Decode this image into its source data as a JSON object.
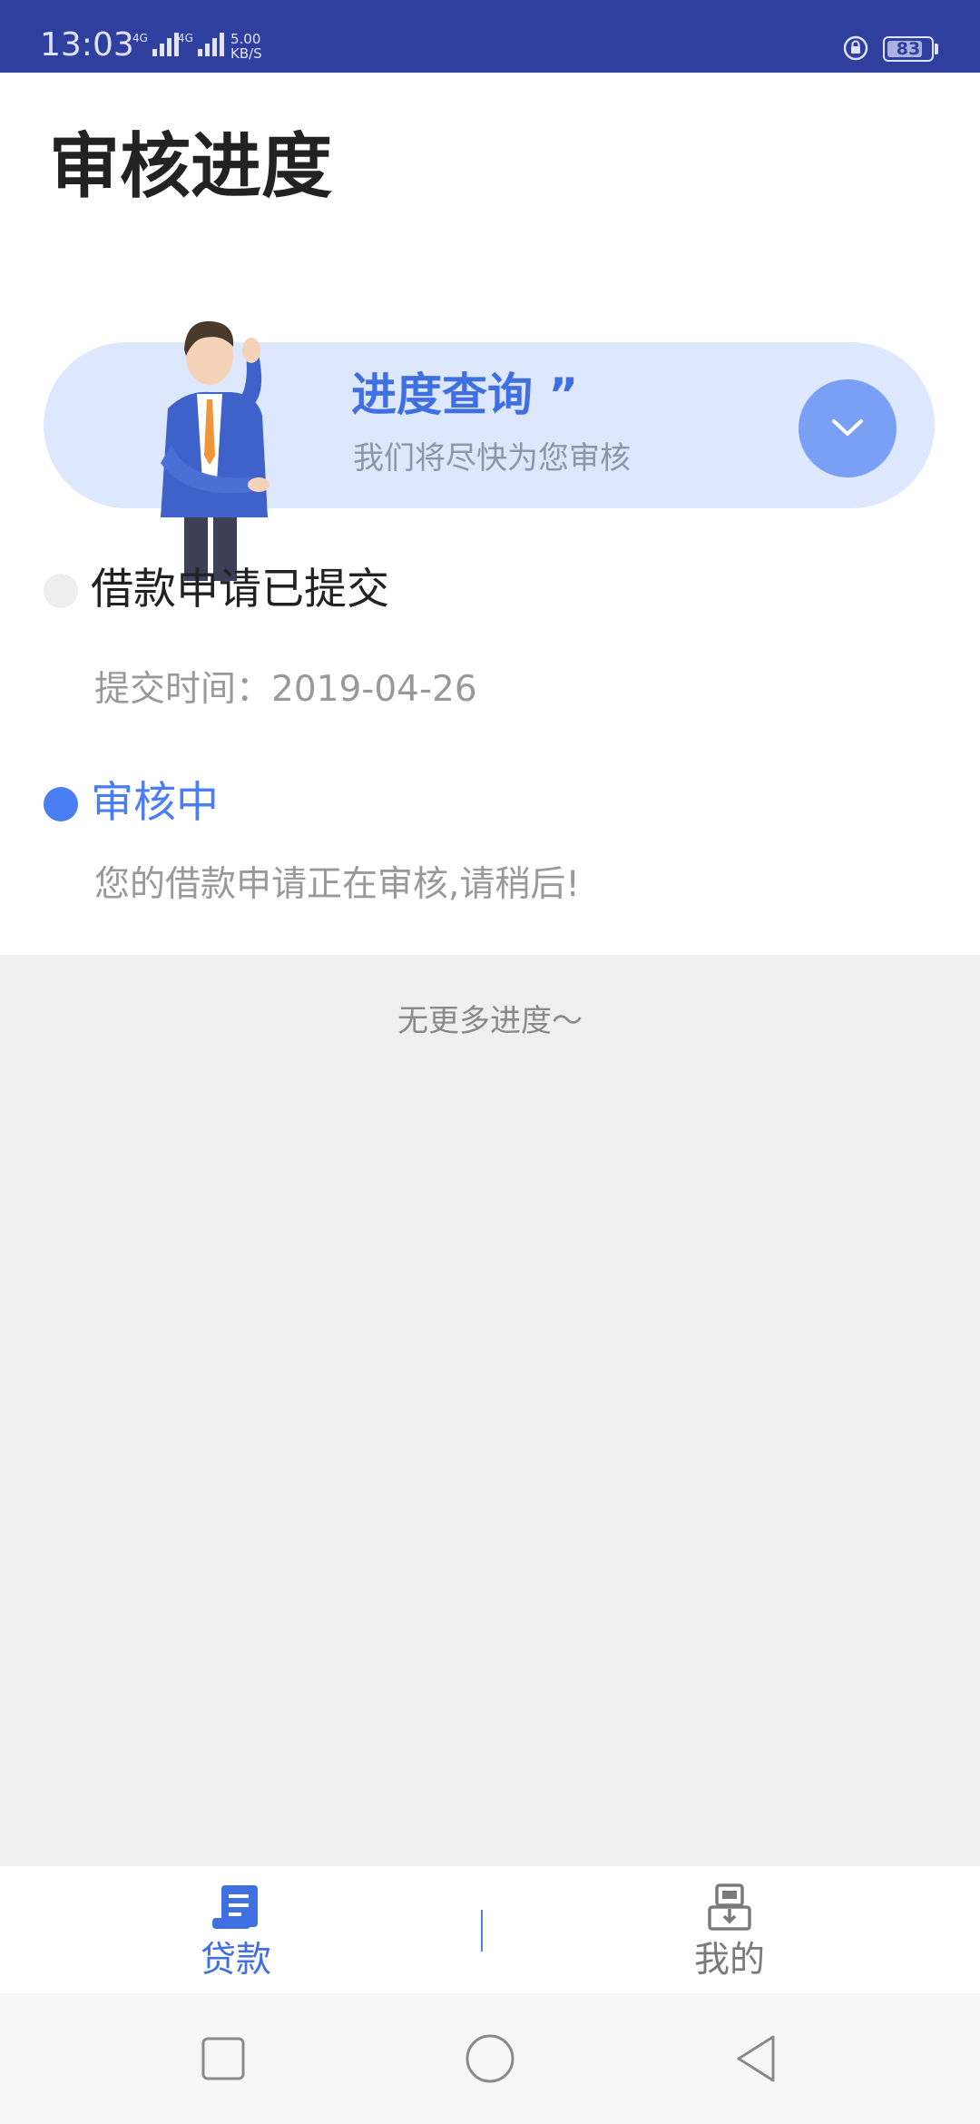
{
  "status_bar": {
    "time": "13:03",
    "signal1_tag": "4G",
    "signal2_tag": "4G",
    "net_speed_value": "5.00",
    "net_speed_unit": "KB/S",
    "battery": "83",
    "battery_level": 0.83,
    "icons": [
      "signal-icon",
      "lock-rotation-icon",
      "battery-icon"
    ]
  },
  "header": {
    "title": "审核进度"
  },
  "banner": {
    "title": "进度查询 ”",
    "subtitle": "我们将尽快为您审核",
    "accent_color": "#3f6fe0",
    "background_color": "#dde7fd",
    "icons": [
      "businessman-illustration",
      "chevron-down-icon"
    ]
  },
  "timeline": [
    {
      "title": "借款申请已提交",
      "detail": "提交时间：2019-04-26",
      "status": "done",
      "dot_color": "#eeeeee"
    },
    {
      "title": "审核中",
      "detail": "您的借款申请正在审核,请稍后!",
      "status": "current",
      "dot_color": "#4b7ef3"
    }
  ],
  "footer_note": "无更多进度～",
  "tab_bar": {
    "items": [
      {
        "label": "贷款",
        "icon": "loan-document-icon",
        "active": true
      },
      {
        "label": "我的",
        "icon": "profile-card-icon",
        "active": false
      }
    ]
  },
  "nav_bar": {
    "icons": [
      "recent-apps-icon",
      "home-icon",
      "back-icon"
    ]
  }
}
